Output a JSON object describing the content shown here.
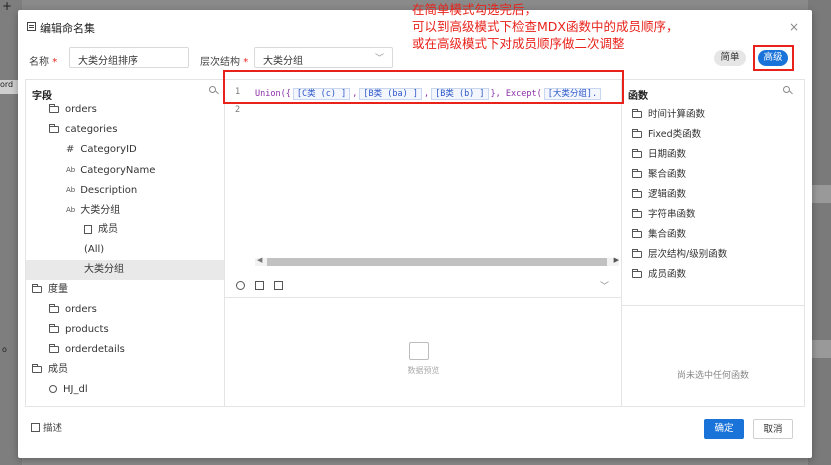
{
  "dialog": {
    "title": "编辑命名集",
    "close_label": "×"
  },
  "annotation": {
    "lines": [
      "在简单模式勾选完后，",
      "可以到高级模式下检查MDX函数中的成员顺序，",
      "或在高级模式下对成员顺序做二次调整"
    ]
  },
  "form": {
    "name_label": "名称",
    "name_required": "*",
    "name_value": "大类分组排序",
    "hierarchy_label": "层次结构",
    "hierarchy_required": "*",
    "hierarchy_value": "大类分组"
  },
  "modes": {
    "simple": "简单",
    "advanced": "高级"
  },
  "fields_panel": {
    "header": "字段",
    "items": [
      {
        "label": "orders"
      },
      {
        "label": "categories"
      },
      {
        "label": "CategoryID",
        "icon": "#"
      },
      {
        "label": "CategoryName",
        "icon": "Ab"
      },
      {
        "label": "Description",
        "icon": "Ab"
      },
      {
        "label": "大类分组",
        "icon": "Ab"
      },
      {
        "label": "成员"
      },
      {
        "label": "(All)"
      },
      {
        "label": "大类分组"
      },
      {
        "label": "度量"
      },
      {
        "label": "orders"
      },
      {
        "label": "products"
      },
      {
        "label": "orderdetails"
      },
      {
        "label": "成员"
      },
      {
        "label": "HJ_dl"
      }
    ]
  },
  "editor": {
    "line1": "1",
    "line2": "2",
    "code_prefix": "Union({",
    "tok1": "[C类 (c) ]",
    "tok2": "[B类 (ba) ]",
    "tok3": "[B类 (b) ]",
    "code_mid": "}, Except(",
    "tok4": "[大类分组]."
  },
  "preview": {
    "label": "数据预览"
  },
  "functions_panel": {
    "header": "函数",
    "items": [
      "时间计算函数",
      "Fixed类函数",
      "日期函数",
      "聚合函数",
      "逻辑函数",
      "字符串函数",
      "集合函数",
      "层次结构/级别函数",
      "成员函数"
    ],
    "empty_text": "尚未选中任何函数"
  },
  "footer": {
    "describe": "描述",
    "ok": "确定",
    "cancel": "取消"
  },
  "background": {
    "plus": "+",
    "left_text_1": "ord",
    "left_text_2": "o"
  }
}
